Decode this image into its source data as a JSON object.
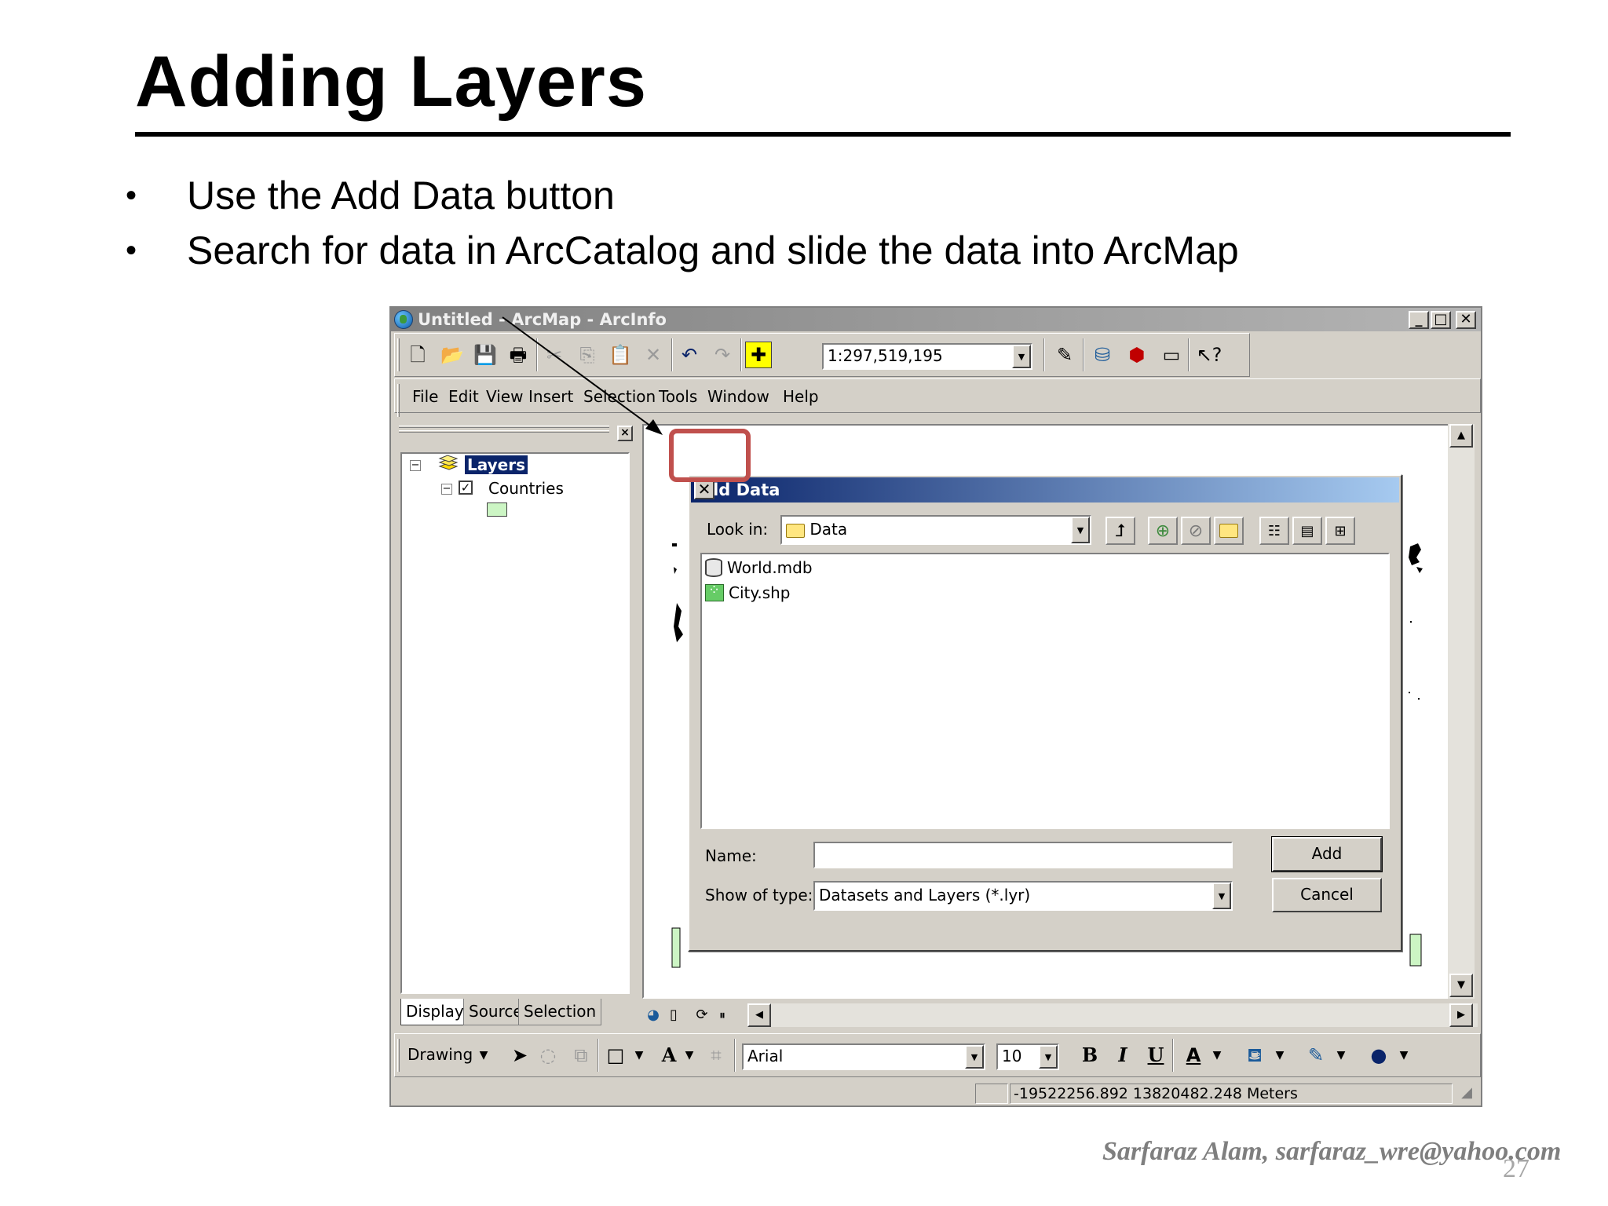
{
  "slide": {
    "title": "Adding Layers",
    "bullets": [
      "Use the Add Data button",
      "Search for data in ArcCatalog and slide the data into ArcMap"
    ],
    "footer": "Sarfaraz Alam, sarfaraz_wre@yahoo.com",
    "page_number": "27"
  },
  "window": {
    "title": "Untitled - ArcMap - ArcInfo",
    "controls": {
      "minimize": "_",
      "maximize": "□",
      "close": "✕"
    },
    "scale": "1:297,519,195",
    "menu": [
      "File",
      "Edit",
      "View",
      "Insert",
      "Selection",
      "Tools",
      "Window",
      "Help"
    ]
  },
  "toc": {
    "root": "Layers",
    "layer": "Countries",
    "tabs": [
      "Display",
      "Source",
      "Selection"
    ]
  },
  "drawing_toolbar": {
    "drawing_label": "Drawing",
    "font": "Arial",
    "font_size": "10",
    "bold": "B",
    "italic": "I",
    "underline": "U"
  },
  "status": {
    "coordinates": "-19522256.892  13820482.248 Meters"
  },
  "add_data_dialog": {
    "title": "Add Data",
    "look_in_label": "Look in:",
    "look_in_value": "Data",
    "files": [
      "World.mdb",
      "City.shp"
    ],
    "name_label": "Name:",
    "name_value": "",
    "show_type_label": "Show of type:",
    "show_type_value": "Datasets and Layers (*.lyr)",
    "add_button": "Add",
    "cancel_button": "Cancel"
  },
  "colors": {
    "highlight": "#c0504d",
    "dialog_title_start": "#0a246a",
    "dialog_title_end": "#a6caf0",
    "window_face": "#d4d0c8"
  }
}
